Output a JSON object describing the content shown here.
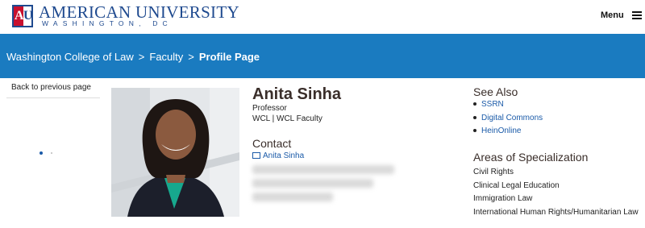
{
  "header": {
    "logo_mark_left": "A",
    "logo_mark_right": "U",
    "logo_title": "AMERICAN UNIVERSITY",
    "logo_subtitle": "WASHINGTON, DC",
    "menu_label": "Menu",
    "menu_icon": "hamburger-icon"
  },
  "breadcrumb": {
    "items": [
      "Washington College of Law",
      "Faculty"
    ],
    "current": "Profile Page",
    "separator": ">"
  },
  "sidebar": {
    "back_link": "Back to previous page"
  },
  "profile": {
    "name": "Anita Sinha",
    "title": "Professor",
    "department": "WCL | WCL Faculty",
    "contact_heading": "Contact",
    "contact_link": "Anita Sinha",
    "contact_icon": "envelope-icon"
  },
  "see_also": {
    "heading": "See Also",
    "links": [
      "SSRN",
      "Digital Commons",
      "HeinOnline"
    ]
  },
  "specialization": {
    "heading": "Areas of Specialization",
    "items": [
      "Civil Rights",
      "Clinical Legal Education",
      "Immigration Law",
      "International Human Rights/Humanitarian Law"
    ]
  },
  "colors": {
    "brand_blue": "#1a7bc0",
    "link_blue": "#1a5aa8",
    "logo_red": "#c8102e",
    "logo_navy": "#1f4a8f"
  }
}
